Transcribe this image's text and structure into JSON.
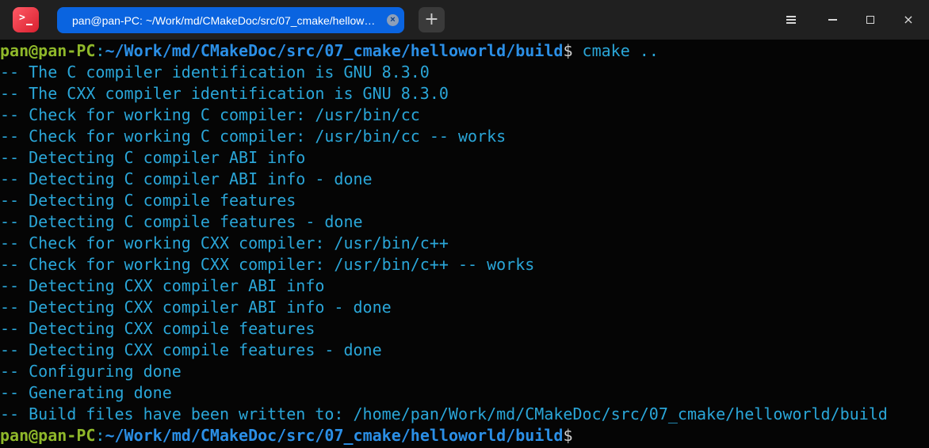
{
  "window": {
    "tab_title": "pan@pan-PC: ~/Work/md/CMakeDoc/src/07_cmake/hellow…",
    "tab_close_glyph": "×",
    "new_tab_glyph": "+",
    "close_glyph": "×"
  },
  "prompt": {
    "user_host": "pan@pan-PC",
    "colon": ":",
    "path": "~/Work/md/CMakeDoc/src/07_cmake/helloworld/build",
    "dollar": "$"
  },
  "command": " cmake ..",
  "output_lines": [
    "-- The C compiler identification is GNU 8.3.0",
    "-- The CXX compiler identification is GNU 8.3.0",
    "-- Check for working C compiler: /usr/bin/cc",
    "-- Check for working C compiler: /usr/bin/cc -- works",
    "-- Detecting C compiler ABI info",
    "-- Detecting C compiler ABI info - done",
    "-- Detecting C compile features",
    "-- Detecting C compile features - done",
    "-- Check for working CXX compiler: /usr/bin/c++",
    "-- Check for working CXX compiler: /usr/bin/c++ -- works",
    "-- Detecting CXX compiler ABI info",
    "-- Detecting CXX compiler ABI info - done",
    "-- Detecting CXX compile features",
    "-- Detecting CXX compile features - done",
    "-- Configuring done",
    "-- Generating done",
    "-- Build files have been written to: /home/pan/Work/md/CMakeDoc/src/07_cmake/helloworld/build"
  ],
  "colors": {
    "user": "#8fb82a",
    "path": "#2b8fe6",
    "output": "#2aa6d8",
    "tab_active": "#0a64e0",
    "titlebar": "#202020",
    "background": "#050505"
  }
}
